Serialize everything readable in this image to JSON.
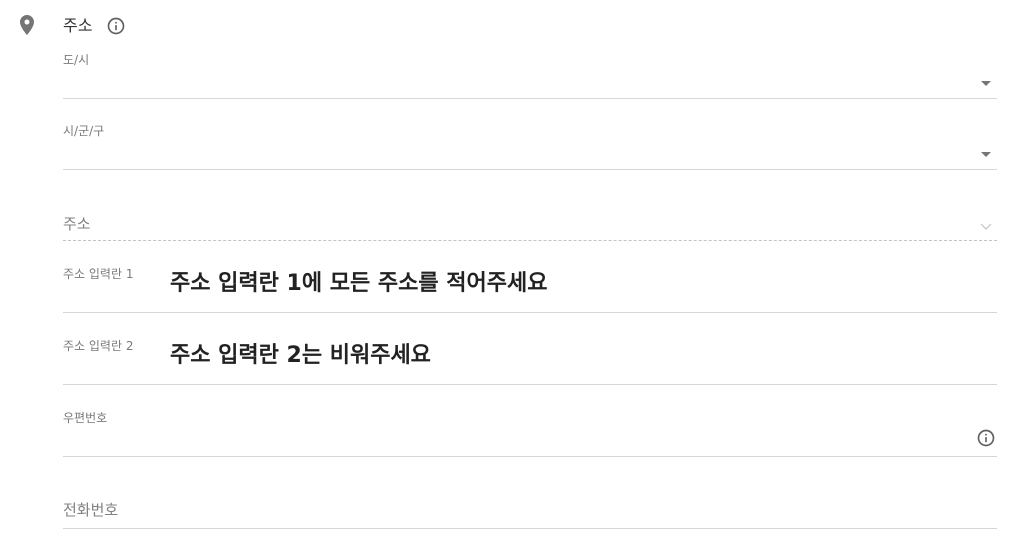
{
  "section": {
    "title": "주소"
  },
  "icons": {
    "pin": "map-pin-icon",
    "info": "info-icon",
    "dropdown": "dropdown-arrow-icon"
  },
  "fields": {
    "province": {
      "label": "도/시"
    },
    "district": {
      "label": "시/군/구"
    },
    "address": {
      "placeholder": "주소"
    },
    "address_line1": {
      "label": "주소 입력란 1",
      "annotation": "주소 입력란 1에 모든 주소를 적어주세요"
    },
    "address_line2": {
      "label": "주소 입력란 2",
      "annotation": "주소 입력란 2는 비워주세요"
    },
    "postal_code": {
      "label": "우편번호"
    },
    "phone": {
      "placeholder": "전화번호"
    }
  },
  "colors": {
    "label": "#7a7a7a",
    "icon": "#757575",
    "underline": "#d6d6d6",
    "annotation": "#222222",
    "title": "#333333"
  }
}
